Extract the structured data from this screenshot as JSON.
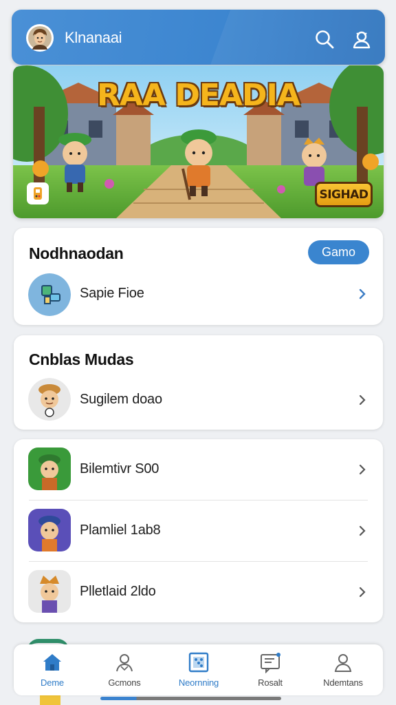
{
  "header": {
    "title": "Klnanaai",
    "avatar_icon": "character-avatar-icon",
    "search_icon": "search-icon",
    "profile_icon": "user-settings-icon",
    "color": "#3d86d0"
  },
  "banner": {
    "title": "RAA DEADIA",
    "button_label": "SIGHAD",
    "corner_icon": "gamepad-icon"
  },
  "section1": {
    "title": "Nodhnaodan",
    "pill_label": "Gamo",
    "items": [
      {
        "label": "Sapie Fioe",
        "icon": "puzzle-map-icon"
      }
    ]
  },
  "section2": {
    "title": "Cnblas Mudas",
    "items": [
      {
        "label": "Sugilem doao",
        "icon": "character-chef-icon"
      }
    ]
  },
  "section3": {
    "items": [
      {
        "label": "Bilemtivr S00",
        "icon": "character-green-cap-icon"
      },
      {
        "label": "Plamliel 1ab8",
        "icon": "character-blue-cap-icon"
      },
      {
        "label": "Plletlaid 2ldo",
        "icon": "character-crown-icon"
      }
    ]
  },
  "nav": {
    "items": [
      {
        "label": "Deme",
        "icon": "home-icon",
        "active": true
      },
      {
        "label": "Gcmons",
        "icon": "person-icon"
      },
      {
        "label": "Neornning",
        "icon": "dice-board-icon"
      },
      {
        "label": "Rosalt",
        "icon": "message-board-icon"
      },
      {
        "label": "Ndemtans",
        "icon": "profile-icon"
      }
    ],
    "accent_color": "#2f7cc8"
  }
}
